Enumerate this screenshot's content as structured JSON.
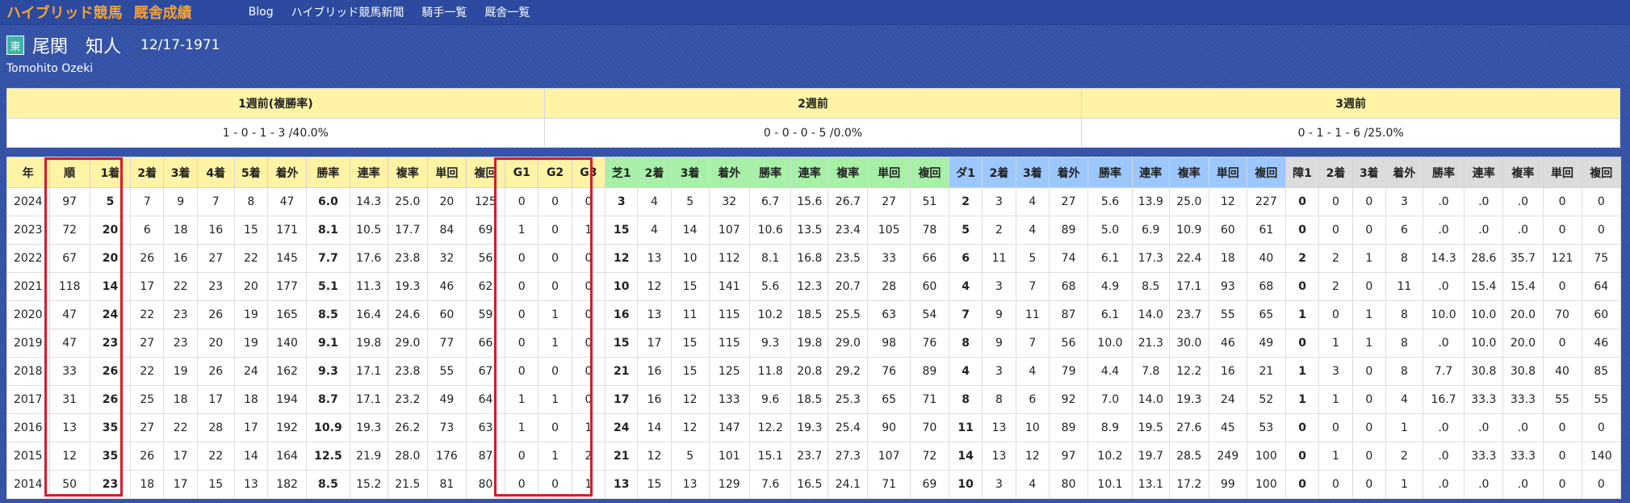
{
  "nav": {
    "brand": "ハイブリッド競馬",
    "section": "厩舎成績",
    "links": [
      "Blog",
      "ハイブリッド競馬新聞",
      "騎手一覧",
      "厩舎一覧"
    ]
  },
  "trainer": {
    "region_badge": "東",
    "name": "尾関　知人",
    "birthdate": "12/17-1971",
    "romaji": "Tomohito Ozeki"
  },
  "weekly": {
    "headers": [
      "1週前(複勝率)",
      "2週前",
      "3週前"
    ],
    "values": [
      "1 - 0 - 1 - 3 /40.0%",
      "0 - 0 - 0 - 5 /0.0%",
      "0 - 1 - 1 - 6 /25.0%"
    ]
  },
  "table": {
    "headers": [
      "年",
      "順",
      "1着",
      "2着",
      "3着",
      "4着",
      "5着",
      "着外",
      "勝率",
      "連率",
      "複率",
      "単回",
      "複回",
      "G1",
      "G2",
      "G3",
      "芝1",
      "2着",
      "3着",
      "着外",
      "勝率",
      "連率",
      "複率",
      "単回",
      "複回",
      "ダ1",
      "2着",
      "3着",
      "着外",
      "勝率",
      "連率",
      "複率",
      "単回",
      "複回",
      "障1",
      "2着",
      "3着",
      "着外",
      "勝率",
      "連率",
      "複率",
      "単回",
      "複回"
    ],
    "rows": [
      [
        "2024",
        "97",
        "5",
        "7",
        "9",
        "7",
        "8",
        "47",
        "6.0",
        "14.3",
        "25.0",
        "20",
        "125",
        "0",
        "0",
        "0",
        "3",
        "4",
        "5",
        "32",
        "6.7",
        "15.6",
        "26.7",
        "27",
        "51",
        "2",
        "3",
        "4",
        "27",
        "5.6",
        "13.9",
        "25.0",
        "12",
        "227",
        "0",
        "0",
        "0",
        "3",
        ".0",
        ".0",
        ".0",
        "0",
        "0"
      ],
      [
        "2023",
        "72",
        "20",
        "6",
        "18",
        "16",
        "15",
        "171",
        "8.1",
        "10.5",
        "17.7",
        "84",
        "69",
        "1",
        "0",
        "1",
        "15",
        "4",
        "14",
        "107",
        "10.6",
        "13.5",
        "23.4",
        "105",
        "78",
        "5",
        "2",
        "4",
        "89",
        "5.0",
        "6.9",
        "10.9",
        "60",
        "61",
        "0",
        "0",
        "0",
        "6",
        ".0",
        ".0",
        ".0",
        "0",
        "0"
      ],
      [
        "2022",
        "67",
        "20",
        "26",
        "16",
        "27",
        "22",
        "145",
        "7.7",
        "17.6",
        "23.8",
        "32",
        "56",
        "0",
        "0",
        "0",
        "12",
        "13",
        "10",
        "112",
        "8.1",
        "16.8",
        "23.5",
        "33",
        "66",
        "6",
        "11",
        "5",
        "74",
        "6.1",
        "17.3",
        "22.4",
        "18",
        "40",
        "2",
        "2",
        "1",
        "8",
        "14.3",
        "28.6",
        "35.7",
        "121",
        "75"
      ],
      [
        "2021",
        "118",
        "14",
        "17",
        "22",
        "23",
        "20",
        "177",
        "5.1",
        "11.3",
        "19.3",
        "46",
        "62",
        "0",
        "0",
        "0",
        "10",
        "12",
        "15",
        "141",
        "5.6",
        "12.3",
        "20.7",
        "28",
        "60",
        "4",
        "3",
        "7",
        "68",
        "4.9",
        "8.5",
        "17.1",
        "93",
        "68",
        "0",
        "2",
        "0",
        "11",
        ".0",
        "15.4",
        "15.4",
        "0",
        "64"
      ],
      [
        "2020",
        "47",
        "24",
        "22",
        "23",
        "26",
        "19",
        "165",
        "8.5",
        "16.4",
        "24.6",
        "60",
        "59",
        "0",
        "1",
        "0",
        "16",
        "13",
        "11",
        "115",
        "10.2",
        "18.5",
        "25.5",
        "63",
        "54",
        "7",
        "9",
        "11",
        "87",
        "6.1",
        "14.0",
        "23.7",
        "55",
        "65",
        "1",
        "0",
        "1",
        "8",
        "10.0",
        "10.0",
        "20.0",
        "70",
        "60"
      ],
      [
        "2019",
        "47",
        "23",
        "27",
        "23",
        "20",
        "19",
        "140",
        "9.1",
        "19.8",
        "29.0",
        "77",
        "66",
        "0",
        "1",
        "0",
        "15",
        "17",
        "15",
        "115",
        "9.3",
        "19.8",
        "29.0",
        "98",
        "76",
        "8",
        "9",
        "7",
        "56",
        "10.0",
        "21.3",
        "30.0",
        "46",
        "49",
        "0",
        "1",
        "1",
        "8",
        ".0",
        "10.0",
        "20.0",
        "0",
        "46"
      ],
      [
        "2018",
        "33",
        "26",
        "22",
        "19",
        "26",
        "24",
        "162",
        "9.3",
        "17.1",
        "23.8",
        "55",
        "67",
        "0",
        "0",
        "0",
        "21",
        "16",
        "15",
        "125",
        "11.8",
        "20.8",
        "29.2",
        "76",
        "89",
        "4",
        "3",
        "4",
        "79",
        "4.4",
        "7.8",
        "12.2",
        "16",
        "21",
        "1",
        "3",
        "0",
        "8",
        "7.7",
        "30.8",
        "30.8",
        "40",
        "85"
      ],
      [
        "2017",
        "31",
        "26",
        "25",
        "18",
        "17",
        "18",
        "194",
        "8.7",
        "17.1",
        "23.2",
        "49",
        "64",
        "1",
        "1",
        "0",
        "17",
        "16",
        "12",
        "133",
        "9.6",
        "18.5",
        "25.3",
        "65",
        "71",
        "8",
        "8",
        "6",
        "92",
        "7.0",
        "14.0",
        "19.3",
        "24",
        "52",
        "1",
        "1",
        "0",
        "4",
        "16.7",
        "33.3",
        "33.3",
        "55",
        "55"
      ],
      [
        "2016",
        "13",
        "35",
        "27",
        "22",
        "28",
        "17",
        "192",
        "10.9",
        "19.3",
        "26.2",
        "73",
        "63",
        "1",
        "0",
        "1",
        "24",
        "14",
        "12",
        "147",
        "12.2",
        "19.3",
        "25.4",
        "90",
        "70",
        "11",
        "13",
        "10",
        "89",
        "8.9",
        "19.5",
        "27.6",
        "45",
        "53",
        "0",
        "0",
        "0",
        "1",
        ".0",
        ".0",
        ".0",
        "0",
        "0"
      ],
      [
        "2015",
        "12",
        "35",
        "26",
        "17",
        "22",
        "14",
        "164",
        "12.5",
        "21.9",
        "28.0",
        "176",
        "87",
        "0",
        "1",
        "2",
        "21",
        "12",
        "5",
        "101",
        "15.1",
        "23.7",
        "27.3",
        "107",
        "72",
        "14",
        "13",
        "12",
        "97",
        "10.2",
        "19.7",
        "28.5",
        "249",
        "100",
        "0",
        "1",
        "0",
        "2",
        ".0",
        "33.3",
        "33.3",
        "0",
        "140"
      ],
      [
        "2014",
        "50",
        "23",
        "18",
        "17",
        "15",
        "13",
        "182",
        "8.5",
        "15.2",
        "21.5",
        "81",
        "80",
        "0",
        "0",
        "1",
        "13",
        "15",
        "13",
        "129",
        "7.6",
        "16.5",
        "24.1",
        "71",
        "69",
        "10",
        "3",
        "4",
        "80",
        "10.1",
        "13.1",
        "17.2",
        "99",
        "100",
        "0",
        "0",
        "0",
        "1",
        ".0",
        ".0",
        ".0",
        "0",
        "0"
      ]
    ]
  },
  "colors": {
    "background": "#3353a8",
    "nav_background": "#2b4aa0",
    "brand": "#f2a23a",
    "header_yellow": "#fff3a6",
    "header_green": "#a8f0a8",
    "header_blue": "#9cc8ff",
    "header_gray": "#dcdcdc",
    "highlight_box": "#e0162b",
    "badge": "#3fb3a8"
  }
}
